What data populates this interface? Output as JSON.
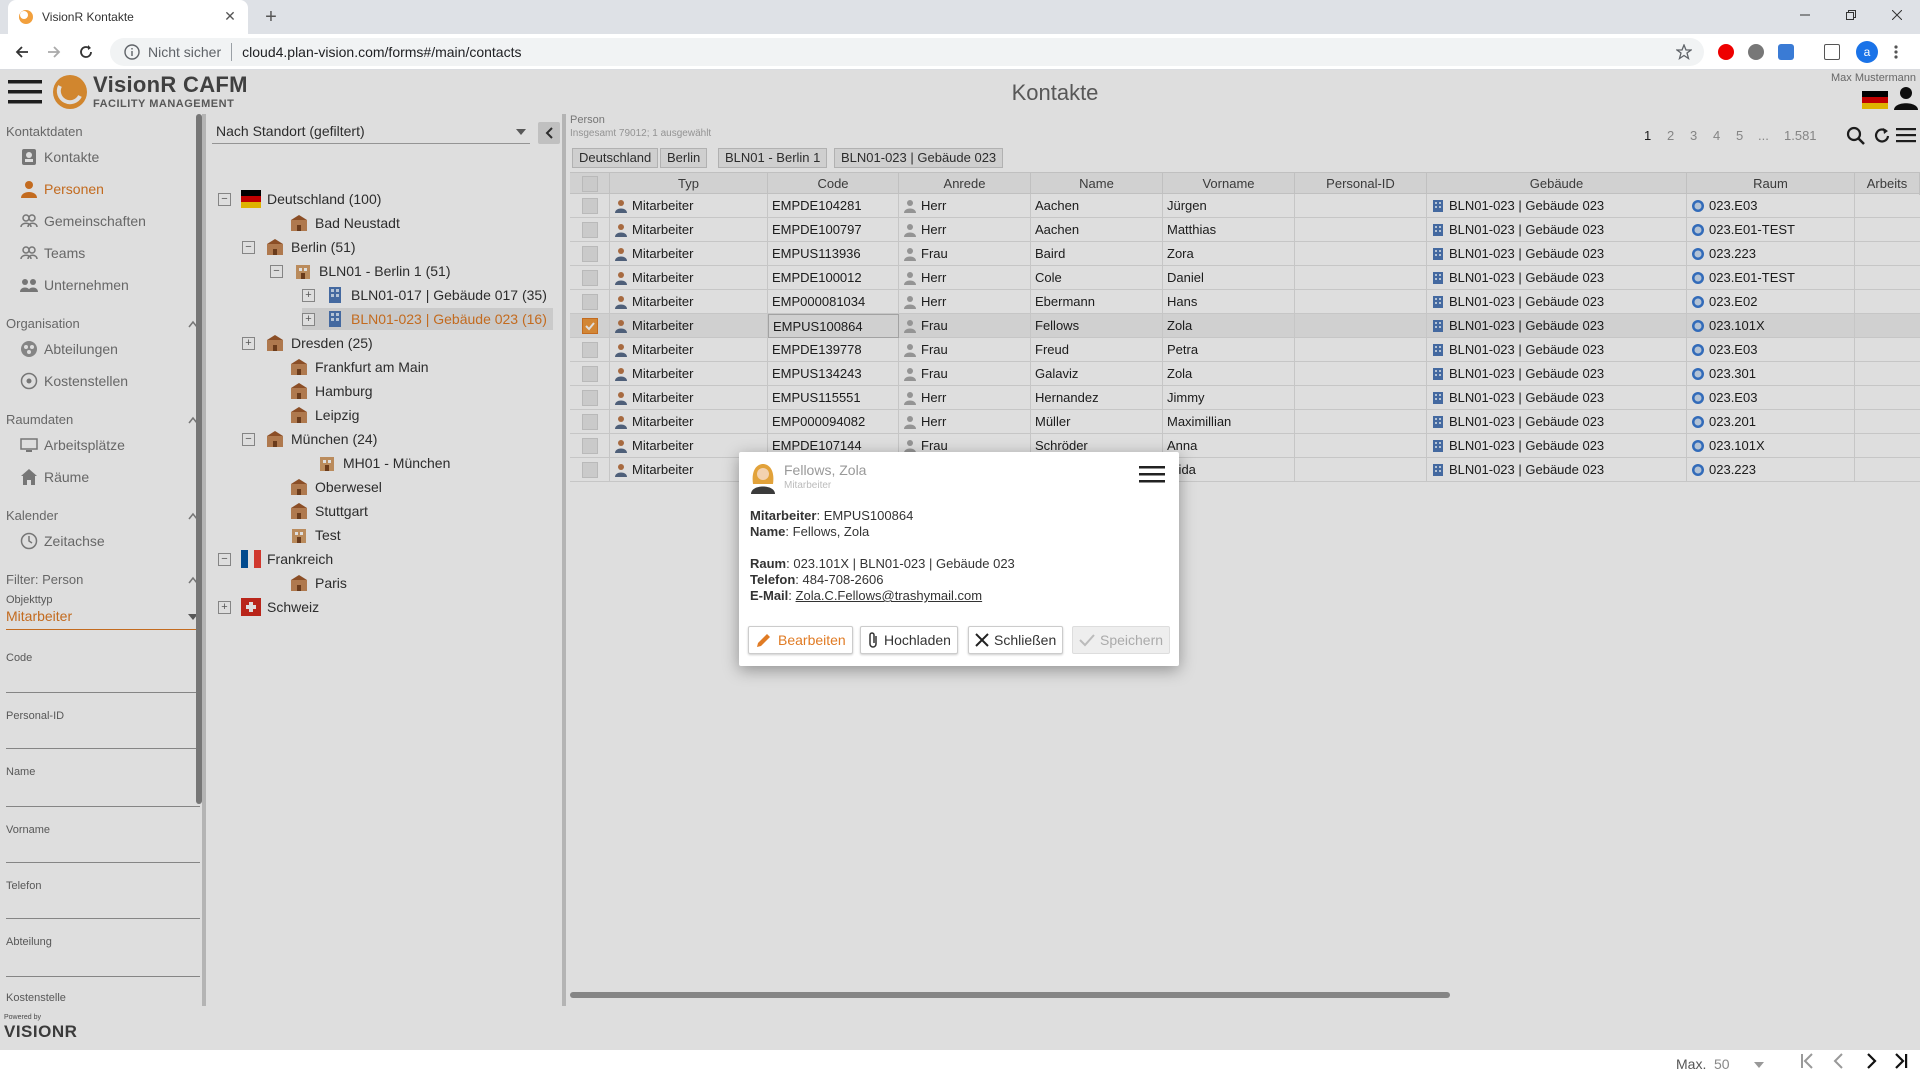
{
  "browser": {
    "tab_title": "VisionR Kontakte",
    "security_label": "Nicht sicher",
    "url": "cloud4.plan-vision.com/forms#/main/contacts",
    "profile_initial": "a"
  },
  "app": {
    "brand": "VisionR CAFM",
    "brand_sub": "FACILITY MANAGEMENT",
    "page_title": "Kontakte",
    "username": "Max Mustermann",
    "powered_by": "Powered by",
    "footer_logo": "VISIONR"
  },
  "nav": {
    "section_contacts": "Kontaktdaten",
    "item_kontakte": "Kontakte",
    "item_personen": "Personen",
    "item_gemeinschaften": "Gemeinschaften",
    "item_teams": "Teams",
    "item_unternehmen": "Unternehmen",
    "section_org": "Organisation",
    "item_abteilungen": "Abteilungen",
    "item_kostenstellen": "Kostenstellen",
    "section_raum": "Raumdaten",
    "item_arbeitsplaetze": "Arbeitsplätze",
    "item_raeume": "Räume",
    "section_kalender": "Kalender",
    "item_zeitachse": "Zeitachse",
    "section_filter": "Filter: Person",
    "objekttyp_label": "Objekttyp",
    "objekttyp_value": "Mitarbeiter",
    "f_code": "Code",
    "f_personal": "Personal-ID",
    "f_name": "Name",
    "f_vorname": "Vorname",
    "f_telefon": "Telefon",
    "f_abteilung": "Abteilung",
    "f_kostenstelle": "Kostenstelle"
  },
  "tree": {
    "selector": "Nach Standort (gefiltert)",
    "n_de": "Deutschland (100)",
    "n_badneustadt": "Bad Neustadt",
    "n_berlin": "Berlin (51)",
    "n_bln01": "BLN01 - Berlin 1 (51)",
    "n_bln017": "BLN01-017 | Gebäude 017 (35)",
    "n_bln023": "BLN01-023 | Gebäude 023 (16)",
    "n_dresden": "Dresden (25)",
    "n_frankfurt": "Frankfurt am Main",
    "n_hamburg": "Hamburg",
    "n_leipzig": "Leipzig",
    "n_muenchen": "München (24)",
    "n_mh01": "MH01 - München",
    "n_oberwesel": "Oberwesel",
    "n_stuttgart": "Stuttgart",
    "n_test": "Test",
    "n_fr": "Frankreich",
    "n_paris": "Paris",
    "n_ch": "Schweiz"
  },
  "main": {
    "entity": "Person",
    "summary": "Insgesamt 79012; 1 ausgewählt",
    "crumbs": [
      "Deutschland",
      "Berlin",
      "BLN01 - Berlin 1",
      "BLN01-023 | Gebäude 023"
    ],
    "pages": [
      "1",
      "2",
      "3",
      "4",
      "5",
      "...",
      "1.581"
    ],
    "max_label": "Max.",
    "max_value": "50"
  },
  "grid": {
    "headers": [
      "Typ",
      "Code",
      "Anrede",
      "Name",
      "Vorname",
      "Personal-ID",
      "Gebäude",
      "Raum",
      "Arbeits"
    ],
    "rows": [
      [
        "Mitarbeiter",
        "EMPDE104281",
        "Herr",
        "Aachen",
        "Jürgen",
        "",
        "BLN01-023 | Gebäude 023",
        "023.E03"
      ],
      [
        "Mitarbeiter",
        "EMPDE100797",
        "Herr",
        "Aachen",
        "Matthias",
        "",
        "BLN01-023 | Gebäude 023",
        "023.E01-TEST"
      ],
      [
        "Mitarbeiter",
        "EMPUS113936",
        "Frau",
        "Baird",
        "Zora",
        "",
        "BLN01-023 | Gebäude 023",
        "023.223"
      ],
      [
        "Mitarbeiter",
        "EMPDE100012",
        "Herr",
        "Cole",
        "Daniel",
        "",
        "BLN01-023 | Gebäude 023",
        "023.E01-TEST"
      ],
      [
        "Mitarbeiter",
        "EMP000081034",
        "Herr",
        "Ebermann",
        "Hans",
        "",
        "BLN01-023 | Gebäude 023",
        "023.E02"
      ],
      [
        "Mitarbeiter",
        "EMPUS100864",
        "Frau",
        "Fellows",
        "Zola",
        "",
        "BLN01-023 | Gebäude 023",
        "023.101X"
      ],
      [
        "Mitarbeiter",
        "EMPDE139778",
        "Frau",
        "Freud",
        "Petra",
        "",
        "BLN01-023 | Gebäude 023",
        "023.E03"
      ],
      [
        "Mitarbeiter",
        "EMPUS134243",
        "Frau",
        "Galaviz",
        "Zola",
        "",
        "BLN01-023 | Gebäude 023",
        "023.301"
      ],
      [
        "Mitarbeiter",
        "EMPUS115551",
        "Herr",
        "Hernandez",
        "Jimmy",
        "",
        "BLN01-023 | Gebäude 023",
        "023.E03"
      ],
      [
        "Mitarbeiter",
        "EMP000094082",
        "Herr",
        "Müller",
        "Maximillian",
        "",
        "BLN01-023 | Gebäude 023",
        "023.201"
      ],
      [
        "Mitarbeiter",
        "EMPDE107144",
        "Frau",
        "Schröder",
        "Anna",
        "",
        "BLN01-023 | Gebäude 023",
        "023.101X"
      ],
      [
        "Mitarbeiter",
        "",
        "",
        "",
        "raida",
        "",
        "BLN01-023 | Gebäude 023",
        "023.223"
      ]
    ]
  },
  "dialog": {
    "title": "Fellows, Zola",
    "subtitle": "Mitarbeiter",
    "l_mitarbeiter": "Mitarbeiter",
    "v_mitarbeiter": ": EMPUS100864",
    "l_name": "Name",
    "v_name": ": Fellows, Zola",
    "l_raum": "Raum",
    "v_raum": ": 023.101X | BLN01-023 | Gebäude 023",
    "l_telefon": "Telefon",
    "v_telefon": ": 484-708-2606",
    "l_email": "E-Mail",
    "v_email_sep": ": ",
    "email": "Zola.C.Fellows@trashymail.com",
    "btn_edit": "Bearbeiten",
    "btn_upload": "Hochladen",
    "btn_close": "Schließen",
    "btn_save": "Speichern"
  },
  "colors": {
    "accent": "#e07b24",
    "check": "#f29a3d"
  }
}
